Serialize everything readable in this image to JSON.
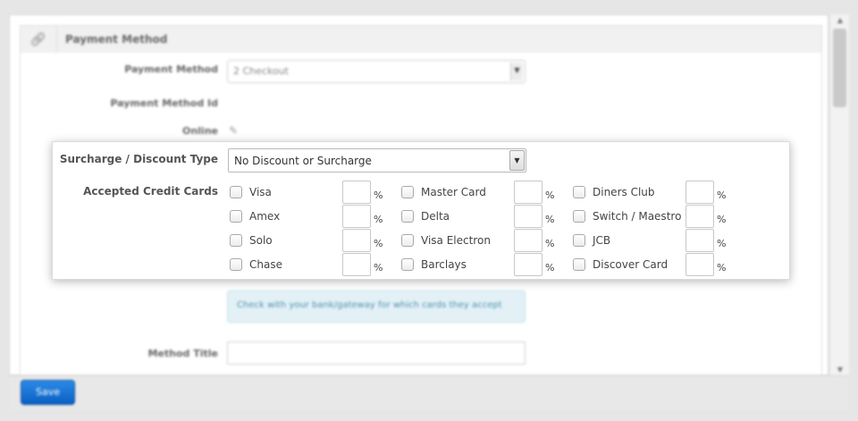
{
  "panel": {
    "title": "Payment Method"
  },
  "form": {
    "payment_method_label": "Payment Method",
    "payment_method_value": "2 Checkout",
    "payment_method_id_label": "Payment Method Id",
    "online_label": "Online",
    "surcharge_label": "Surcharge / Discount Type",
    "surcharge_value": "No Discount or Surcharge",
    "accepted_cards_label": "Accepted Credit Cards",
    "hint_text": "Check with your bank/gateway for which cards they accept",
    "method_title_label": "Method Title"
  },
  "cards": {
    "percent_symbol": "%",
    "col1": [
      "Visa",
      "Amex",
      "Solo",
      "Chase"
    ],
    "col2": [
      "Master Card",
      "Delta",
      "Visa Electron",
      "Barclays"
    ],
    "col3": [
      "Diners Club",
      "Switch / Maestro",
      "JCB",
      "Discover Card"
    ]
  },
  "footer": {
    "save_label": "Save"
  },
  "icons": {
    "header": "link-icon",
    "online": "pencil-icon",
    "select_arrow": "chevron-down-icon"
  }
}
